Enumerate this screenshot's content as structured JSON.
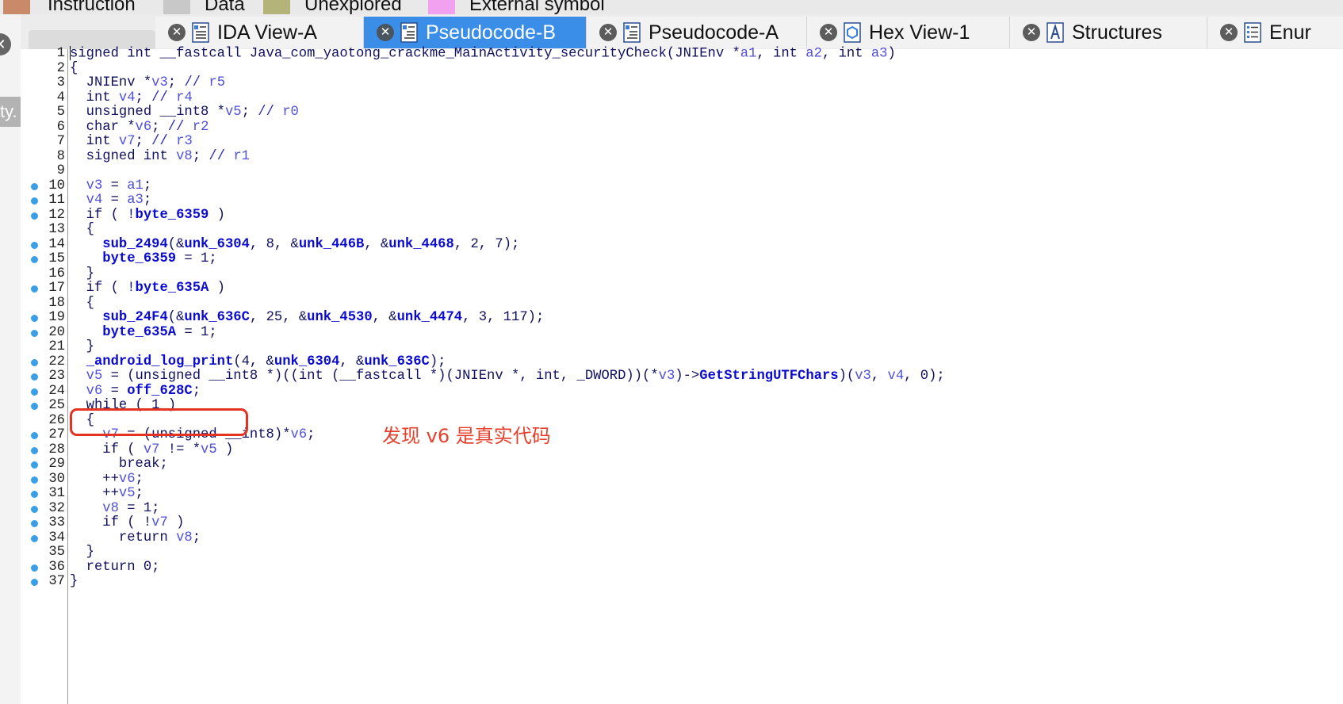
{
  "legend": {
    "items": [
      {
        "label": "Instruction",
        "color": "#c98a6a"
      },
      {
        "label": "Data",
        "color": "#c8c8c8"
      },
      {
        "label": "Unexplored",
        "color": "#b3b37a"
      },
      {
        "label": "External symbol",
        "color": "#f2a0f0"
      }
    ]
  },
  "sidebar": {
    "partial_label": "ty."
  },
  "tabs": [
    {
      "label": "IDA View-A",
      "icon": "listing-icon",
      "active": false
    },
    {
      "label": "Pseudocode-B",
      "icon": "pseudocode-icon",
      "active": true
    },
    {
      "label": "Pseudocode-A",
      "icon": "pseudocode-icon",
      "active": false
    },
    {
      "label": "Hex View-1",
      "icon": "hex-icon",
      "active": false
    },
    {
      "label": "Structures",
      "icon": "structures-icon",
      "active": false
    },
    {
      "label": "Enur",
      "icon": "enums-icon",
      "active": false
    }
  ],
  "code": {
    "lines": [
      {
        "n": "1",
        "dot": false,
        "text": "signed int __fastcall Java_com_yaotong_crackme_MainActivity_securityCheck(JNIEnv *a1, int a2, int a3)"
      },
      {
        "n": "2",
        "dot": false,
        "text": "{"
      },
      {
        "n": "3",
        "dot": false,
        "text": "  JNIEnv *v3; // r5"
      },
      {
        "n": "4",
        "dot": false,
        "text": "  int v4; // r4"
      },
      {
        "n": "5",
        "dot": false,
        "text": "  unsigned __int8 *v5; // r0"
      },
      {
        "n": "6",
        "dot": false,
        "text": "  char *v6; // r2"
      },
      {
        "n": "7",
        "dot": false,
        "text": "  int v7; // r3"
      },
      {
        "n": "8",
        "dot": false,
        "text": "  signed int v8; // r1"
      },
      {
        "n": "9",
        "dot": false,
        "text": ""
      },
      {
        "n": "10",
        "dot": true,
        "text": "  v3 = a1;"
      },
      {
        "n": "11",
        "dot": true,
        "text": "  v4 = a3;"
      },
      {
        "n": "12",
        "dot": true,
        "text": "  if ( !byte_6359 )"
      },
      {
        "n": "13",
        "dot": false,
        "text": "  {"
      },
      {
        "n": "14",
        "dot": true,
        "text": "    sub_2494(&unk_6304, 8, &unk_446B, &unk_4468, 2, 7);"
      },
      {
        "n": "15",
        "dot": true,
        "text": "    byte_6359 = 1;"
      },
      {
        "n": "16",
        "dot": false,
        "text": "  }"
      },
      {
        "n": "17",
        "dot": true,
        "text": "  if ( !byte_635A )"
      },
      {
        "n": "18",
        "dot": false,
        "text": "  {"
      },
      {
        "n": "19",
        "dot": true,
        "text": "    sub_24F4(&unk_636C, 25, &unk_4530, &unk_4474, 3, 117);"
      },
      {
        "n": "20",
        "dot": true,
        "text": "    byte_635A = 1;"
      },
      {
        "n": "21",
        "dot": false,
        "text": "  }"
      },
      {
        "n": "22",
        "dot": true,
        "text": "  _android_log_print(4, &unk_6304, &unk_636C);"
      },
      {
        "n": "23",
        "dot": true,
        "text": "  v5 = (unsigned __int8 *)((int (__fastcall *)(JNIEnv *, int, _DWORD))(*v3)->GetStringUTFChars)(v3, v4, 0);"
      },
      {
        "n": "24",
        "dot": true,
        "text": "  v6 = off_628C;"
      },
      {
        "n": "25",
        "dot": true,
        "text": "  while ( 1 )"
      },
      {
        "n": "26",
        "dot": false,
        "text": "  {"
      },
      {
        "n": "27",
        "dot": true,
        "text": "    v7 = (unsigned __int8)*v6;"
      },
      {
        "n": "28",
        "dot": true,
        "text": "    if ( v7 != *v5 )"
      },
      {
        "n": "29",
        "dot": true,
        "text": "      break;"
      },
      {
        "n": "30",
        "dot": true,
        "text": "    ++v6;"
      },
      {
        "n": "31",
        "dot": true,
        "text": "    ++v5;"
      },
      {
        "n": "32",
        "dot": true,
        "text": "    v8 = 1;"
      },
      {
        "n": "33",
        "dot": true,
        "text": "    if ( !v7 )"
      },
      {
        "n": "34",
        "dot": true,
        "text": "      return v8;"
      },
      {
        "n": "35",
        "dot": false,
        "text": "  }"
      },
      {
        "n": "36",
        "dot": true,
        "text": "  return 0;"
      },
      {
        "n": "37",
        "dot": true,
        "text": "}"
      }
    ]
  },
  "annotation": {
    "text": "发现 v6 是真实代码",
    "color": "#e53322"
  }
}
